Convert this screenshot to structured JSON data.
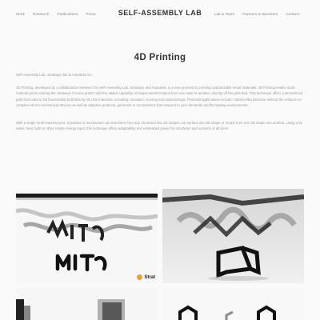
{
  "header": {
    "brand": "SELF-ASSEMBLY LAB",
    "nav_left": [
      "Work",
      "Research",
      "Publications",
      "Press"
    ],
    "nav_right": [
      "Lab & Team",
      "Partners & Sponsors",
      "Contact"
    ]
  },
  "article": {
    "title": "4D Printing",
    "credit": "Self-Assembly Lab, Stratasys ltd. & Autodesk inc.",
    "paragraph1": "4D Printing, developed as a collaboration between the Self-Assembly Lab, Stratasys and Autodesk, is a new process for printing customizable smart materials. 4D Printing entails multi-material prints utilizing the Stratasys Connex printer with the added capability of shape-transformation from one state to another, directly off the print-bed. This technique offers a streamlined path from idea to full functionality built directly into the materials, including: actuation, sensing and material logic. Potential applications include; robotics-like behavior without the reliance on complex electro-mechanical devices as well as adaptive products, garments or mechanisms that respond to user-demands and fluctuating environments.",
    "paragraph2": "With a single multi-material print, a product or mechanism can transform from any 1D strand into 3D shapes, 2D surface into 3D shape or morph from one 3D shape into another. Using only water, heat, light or other simple energy input, this technique offers adaptability and embedded power for structures and systems of all sizes."
  },
  "gallery": {
    "image1_logo": "Strat",
    "image1_word": "MIT"
  },
  "colors": {
    "background": "#fafafa",
    "text_dark": "#333333",
    "text_muted": "#9a9a9a",
    "logo_accent": "#e8a23a"
  }
}
